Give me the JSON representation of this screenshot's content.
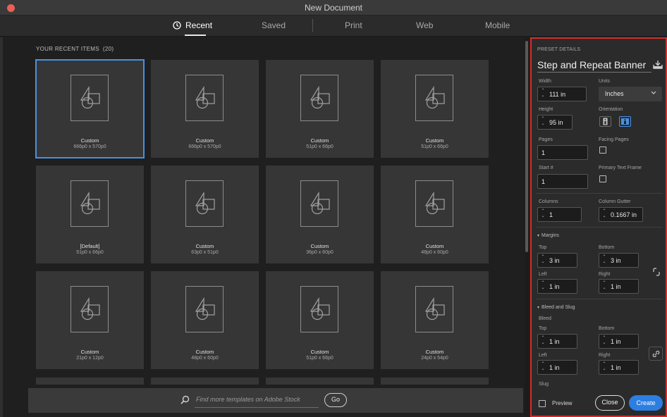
{
  "window": {
    "title": "New Document"
  },
  "tabs": [
    {
      "label": "Recent",
      "active": true
    },
    {
      "label": "Saved"
    },
    {
      "label": "Print"
    },
    {
      "label": "Web"
    },
    {
      "label": "Mobile"
    }
  ],
  "recent": {
    "header": "YOUR RECENT ITEMS",
    "count": "(20)",
    "items": [
      {
        "name": "Custom",
        "dims": "666p0 x 570p0",
        "selected": true
      },
      {
        "name": "Custom",
        "dims": "666p0 x 570p0"
      },
      {
        "name": "Custom",
        "dims": "51p0 x 66p0"
      },
      {
        "name": "Custom",
        "dims": "51p0 x 66p0"
      },
      {
        "name": "[Default]",
        "dims": "51p0 x 66p0"
      },
      {
        "name": "Custom",
        "dims": "63p0 x 51p0"
      },
      {
        "name": "Custom",
        "dims": "36p0 x 60p0"
      },
      {
        "name": "Custom",
        "dims": "48p0 x 60p0"
      },
      {
        "name": "Custom",
        "dims": "21p0 x 12p0"
      },
      {
        "name": "Custom",
        "dims": "48p0 x 60p0"
      },
      {
        "name": "Custom",
        "dims": "51p0 x 66p0"
      },
      {
        "name": "Custom",
        "dims": "24p0 x 54p0"
      }
    ]
  },
  "stock": {
    "placeholder": "Find more templates on Adobe Stock",
    "go_label": "Go"
  },
  "preset": {
    "section_label": "PRESET DETAILS",
    "name": "Step and Repeat Banner",
    "width_label": "Width",
    "width": "111 in",
    "units_label": "Units",
    "units": "Inches",
    "height_label": "Height",
    "height": "95 in",
    "orientation_label": "Orientation",
    "pages_label": "Pages",
    "pages": "1",
    "facing_pages_label": "Facing Pages",
    "start_label": "Start #",
    "start": "1",
    "primary_text_frame_label": "Primary Text Frame",
    "columns_label": "Columns",
    "columns": "1",
    "gutter_label": "Column Gutter",
    "gutter": "0.1667 in",
    "margins": {
      "title": "Margins",
      "top_label": "Top",
      "top": "3 in",
      "bottom_label": "Bottom",
      "bottom": "3 in",
      "left_label": "Left",
      "left": "1 in",
      "right_label": "Right",
      "right": "1 in"
    },
    "bleed_slug": {
      "title": "Bleed and Slug",
      "bleed_label": "Bleed",
      "top_label": "Top",
      "top": "1 in",
      "bottom_label": "Bottom",
      "bottom": "1 in",
      "left_label": "Left",
      "left": "1 in",
      "right_label": "Right",
      "right": "1 in",
      "slug_label": "Slug"
    },
    "preview_label": "Preview",
    "close_label": "Close",
    "create_label": "Create"
  },
  "colors": {
    "accent": "#2d7ee1",
    "highlight_border": "#d62b2b",
    "selected_border": "#4a90e2"
  }
}
